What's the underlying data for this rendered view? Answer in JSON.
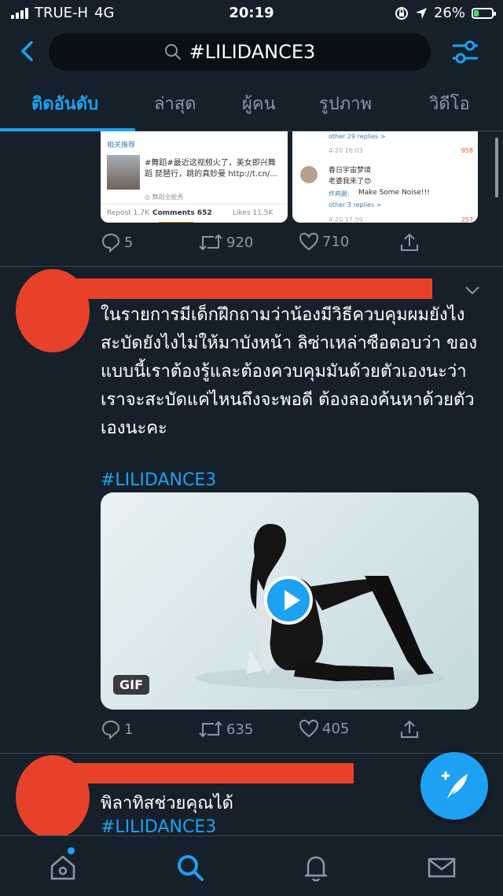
{
  "status_bar": {
    "carrier": "TRUE-H",
    "network": "4G",
    "time": "20:19",
    "battery_percent": "26%",
    "battery_level": 0.26,
    "battery_color": "#4cd964"
  },
  "search": {
    "query": "#LILIDANCE3",
    "icon": "search-icon"
  },
  "tabs": [
    {
      "label": "ติดอันดับ",
      "active": true
    },
    {
      "label": "ล่าสุด",
      "active": false
    },
    {
      "label": "ผู้คน",
      "active": false
    },
    {
      "label": "รูปภาพ",
      "active": false
    },
    {
      "label": "วิดีโอ",
      "active": false
    }
  ],
  "tweet1": {
    "card_left": {
      "header": "相关推荐",
      "text": "#舞蹈#最近这视频火了，美女即兴舞蹈 琵琶行，跳的真妙曼 http://t.cn/...",
      "source": "◎ 舞蹈全能秀",
      "repost": "Repost 1.7K",
      "comments": "Comments 652",
      "likes": "Likes 11.5K"
    },
    "card_right": {
      "replies_top": "other 29 replies >",
      "date1": "4-20 16:03",
      "likes1": "958",
      "name": "春日宇宙梦境",
      "comment": "老婆我来了😍",
      "reply_name": "炸鸡腿:",
      "reply_text": "Make Some Noise!!!",
      "replies_bottom": "other 3 replies >",
      "date2": "4-20 17:59",
      "likes2": "257"
    },
    "replies": "5",
    "retweets": "920",
    "likes": "710"
  },
  "tweet2": {
    "text": "ในรายการมีเด็กฝึกถามว่าน้องมีวิธีควบคุมผมยังไงสะบัดยังไงไม่ให้มาบังหน้า  ลิซ่าเหล่าซือตอบว่า ของแบบนี้เราต้องรู้และต้องควบคุมมันด้วยตัวเองนะว่าเราจะสะบัดแค่ไหนถึงจะพอดี ต้องลองค้นหาด้วยตัวเองนะคะ",
    "hashtag": "#LILIDANCE3",
    "media_badge": "GIF",
    "replies": "1",
    "retweets": "635",
    "likes": "405"
  },
  "tweet3": {
    "text": "พิลาทิสช่วยคุณได้",
    "hashtag": "#LILIDANCE3"
  },
  "colors": {
    "accent": "#1da1f2",
    "background": "#15202b",
    "muted": "#8899a6",
    "redaction": "#e8412a"
  },
  "bottom_nav": [
    "home-icon",
    "search-icon",
    "bell-icon",
    "mail-icon"
  ]
}
